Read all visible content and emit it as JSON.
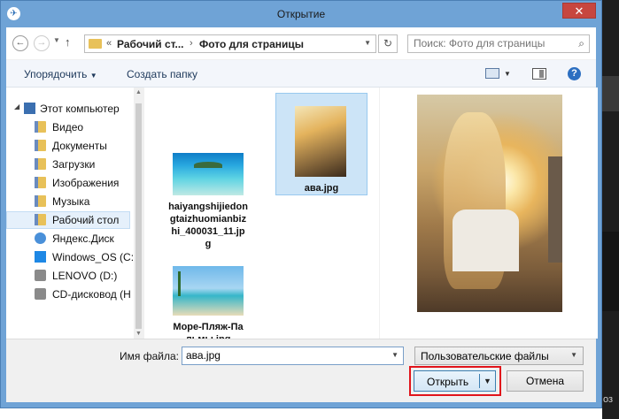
{
  "window": {
    "title": "Открытие",
    "close_glyph": "✕"
  },
  "address_bar": {
    "history_glyph": "«",
    "crumbs": [
      "Рабочий ст...",
      "Фото для страницы"
    ],
    "separator": "›"
  },
  "search": {
    "placeholder": "Поиск: Фото для страницы"
  },
  "toolbar": {
    "organize_label": "Упорядочить",
    "new_folder_label": "Создать папку"
  },
  "nav_pane": {
    "items": [
      {
        "label": "Этот компьютер",
        "icon": "computer-icon"
      },
      {
        "label": "Видео",
        "icon": "folder-icon"
      },
      {
        "label": "Документы",
        "icon": "folder-icon"
      },
      {
        "label": "Загрузки",
        "icon": "folder-icon"
      },
      {
        "label": "Изображения",
        "icon": "folder-icon"
      },
      {
        "label": "Музыка",
        "icon": "folder-icon"
      },
      {
        "label": "Рабочий стол",
        "icon": "folder-icon",
        "selected": true
      },
      {
        "label": "Яндекс.Диск",
        "icon": "cloud-drive-icon"
      },
      {
        "label": "Windows_OS (C:",
        "icon": "windows-drive-icon"
      },
      {
        "label": "LENOVO (D:)",
        "icon": "drive-icon"
      },
      {
        "label": "CD-дисковод (H",
        "icon": "cd-drive-icon"
      }
    ]
  },
  "files": [
    {
      "name": "haiyangshijiedongtaizhuomianbizhi_400031_11.jpg",
      "lines": [
        "haiyangshijiedon",
        "gtaizhuomianbiz",
        "hi_400031_11.jp",
        "g"
      ],
      "selected": false
    },
    {
      "name": "ава.jpg",
      "lines": [
        "ава.jpg"
      ],
      "selected": true
    },
    {
      "name": "Море-Пляж-Пальмы.jpg",
      "lines": [
        "Море-Пляж-Па",
        "льмы.jpg"
      ],
      "selected": false
    }
  ],
  "bottom": {
    "filename_label": "Имя файла:",
    "filename_value": "ава.jpg",
    "file_type": "Пользовательские файлы",
    "open_label": "Открыть",
    "cancel_label": "Отмена"
  },
  "background": {
    "partial_text": "оз"
  },
  "colors": {
    "frame": "#6fa3d6",
    "close_button": "#c7463f",
    "highlight_box": "#e1141b",
    "selection": "#cce4f7"
  }
}
